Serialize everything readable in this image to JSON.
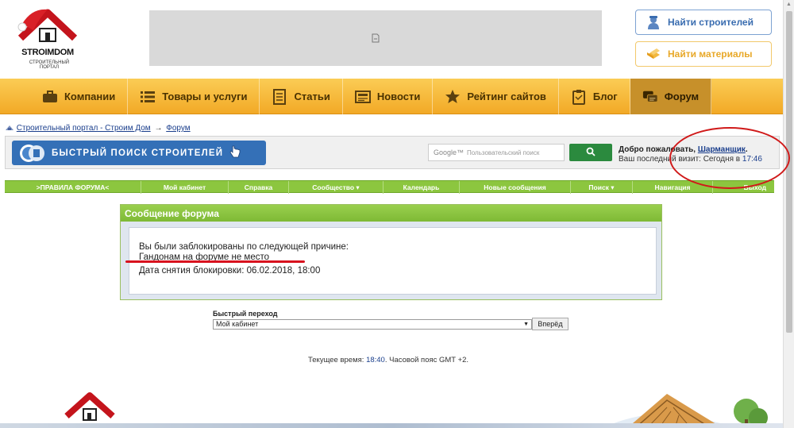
{
  "header": {
    "logo_text": "STROIMDOM",
    "logo_subtitle": "СТРОИТЕЛЬНЫЙ ПОРТАЛ",
    "find_builders": "Найти строителей",
    "find_materials": "Найти материалы"
  },
  "mainnav": [
    {
      "label": "Компании",
      "icon": "briefcase-icon"
    },
    {
      "label": "Товары и услуги",
      "icon": "list-icon"
    },
    {
      "label": "Статьи",
      "icon": "document-icon"
    },
    {
      "label": "Новости",
      "icon": "newspaper-icon"
    },
    {
      "label": "Рейтинг сайтов",
      "icon": "star-icon"
    },
    {
      "label": "Блог",
      "icon": "clipboard-icon"
    },
    {
      "label": "Форум",
      "icon": "chat-icon",
      "active": true
    }
  ],
  "breadcrumb": {
    "portal": "Строительный портал - Строим Дом",
    "arrow": "→",
    "forum": "Форум"
  },
  "searchbar": {
    "fast_search": "БЫСТРЫЙ ПОИСК СТРОИТЕЛЕЙ",
    "google_brand": "Google™",
    "google_placeholder": "Пользовательский поиск",
    "welcome": "Добро пожаловать,",
    "username": "Шарманщик",
    "last_visit": "Ваш последний визит: Сегодня в",
    "last_visit_time": "17:46"
  },
  "forumnav": [
    ">ПРАВИЛА ФОРУМА<",
    "Мой кабинет",
    "Справка",
    "Сообщество ▾",
    "Календарь",
    "Новые сообщения",
    "Поиск ▾",
    "Навигация",
    "Выход"
  ],
  "message": {
    "title": "Сообщение форума",
    "line1": "Вы были заблокированы по следующей причине:",
    "line2": "Гандонам на форуме не место",
    "unblock_label": "Дата снятия блокировки:",
    "unblock_value": "06.02.2018, 18:00"
  },
  "quickjump": {
    "label": "Быстрый переход",
    "selected": "Мой кабинет",
    "go": "Вперёд"
  },
  "footer": {
    "time_label": "Текущее время:",
    "time_value": "18:40",
    "timezone": ". Часовой пояс GMT +2."
  },
  "colors": {
    "nav_orange": "#f2a926",
    "forum_green": "#8cc63f",
    "link_blue": "#1a3e8c",
    "annotation_red": "#d01a1a"
  }
}
